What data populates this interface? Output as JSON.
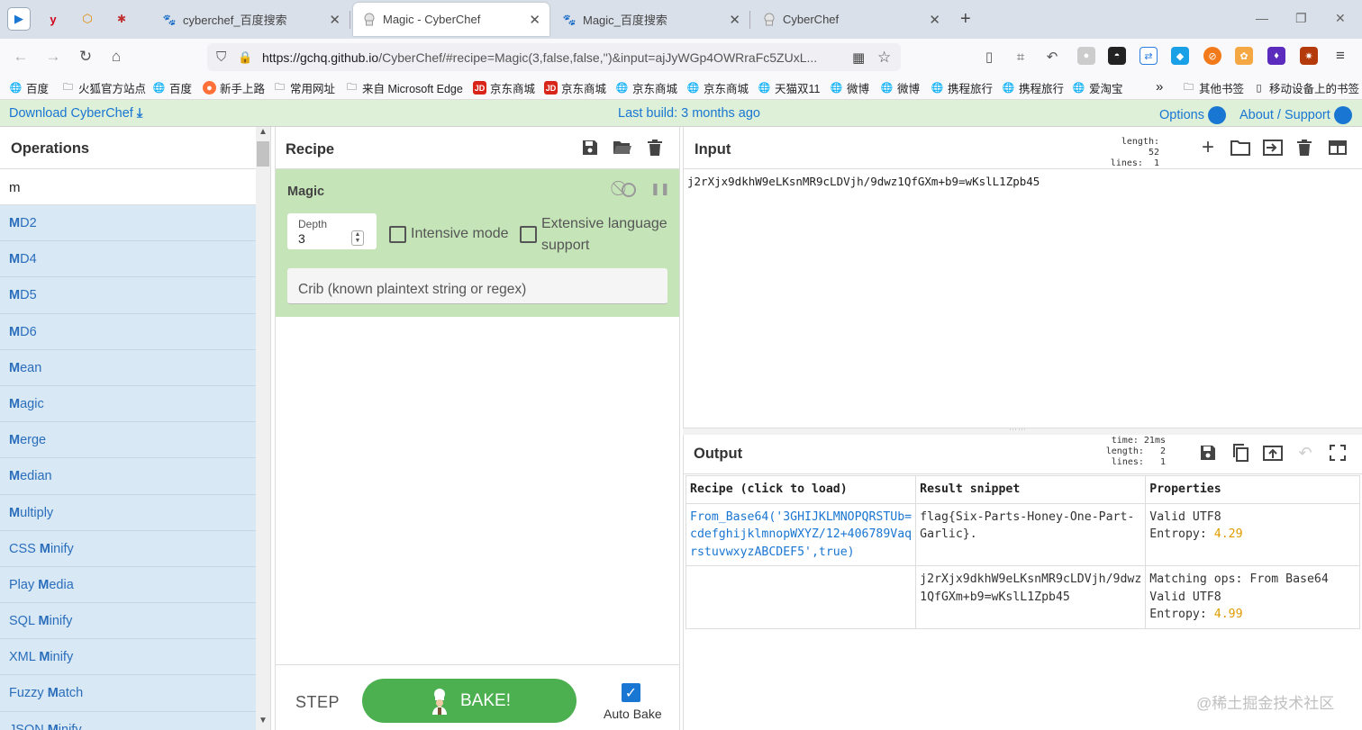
{
  "browser": {
    "tabs": [
      {
        "title": "cyberchef_百度搜索",
        "active": false
      },
      {
        "title": "Magic - CyberChef",
        "active": true
      },
      {
        "title": "Magic_百度搜索",
        "active": false
      },
      {
        "title": "CyberChef",
        "active": false
      }
    ],
    "new_tab_symbol": "+",
    "url_host": "https://gchq.github.io",
    "url_rest": "/CyberChef/#recipe=Magic(3,false,false,'')&input=ajJyWGp4OWRraFc5ZUxL..."
  },
  "bookmarks": [
    {
      "label": "百度",
      "icon": "globe-icon"
    },
    {
      "label": "火狐官方站点",
      "icon": "folder-icon"
    },
    {
      "label": "百度",
      "icon": "globe-icon"
    },
    {
      "label": "新手上路",
      "icon": "firefox-icon"
    },
    {
      "label": "常用网址",
      "icon": "folder-icon"
    },
    {
      "label": "来自 Microsoft Edge",
      "icon": "folder-icon"
    },
    {
      "label": "京东商城",
      "icon": "jd-icon"
    },
    {
      "label": "京东商城",
      "icon": "jd-icon"
    },
    {
      "label": "京东商城",
      "icon": "globe-icon"
    },
    {
      "label": "京东商城",
      "icon": "globe-icon"
    },
    {
      "label": "天猫双11",
      "icon": "globe-icon"
    },
    {
      "label": "微博",
      "icon": "globe-icon"
    },
    {
      "label": "微博",
      "icon": "globe-icon"
    },
    {
      "label": "携程旅行",
      "icon": "globe-icon"
    },
    {
      "label": "携程旅行",
      "icon": "globe-icon"
    },
    {
      "label": "爱淘宝",
      "icon": "globe-icon"
    }
  ],
  "bookmarks_right": [
    {
      "label": "其他书签",
      "icon": "folder-icon"
    },
    {
      "label": "移动设备上的书签",
      "icon": "mobile-icon"
    }
  ],
  "banner": {
    "download": "Download CyberChef",
    "last_build": "Last build: 3 months ago",
    "options": "Options",
    "about": "About / Support"
  },
  "operations": {
    "title": "Operations",
    "search_value": "m",
    "items": [
      {
        "pre": "",
        "match": "M",
        "post": "D2"
      },
      {
        "pre": "",
        "match": "M",
        "post": "D4"
      },
      {
        "pre": "",
        "match": "M",
        "post": "D5"
      },
      {
        "pre": "",
        "match": "M",
        "post": "D6"
      },
      {
        "pre": "",
        "match": "M",
        "post": "ean"
      },
      {
        "pre": "",
        "match": "M",
        "post": "agic"
      },
      {
        "pre": "",
        "match": "M",
        "post": "erge"
      },
      {
        "pre": "",
        "match": "M",
        "post": "edian"
      },
      {
        "pre": "",
        "match": "M",
        "post": "ultiply"
      },
      {
        "pre": "CSS ",
        "match": "M",
        "post": "inify"
      },
      {
        "pre": "Play ",
        "match": "M",
        "post": "edia"
      },
      {
        "pre": "SQL ",
        "match": "M",
        "post": "inify"
      },
      {
        "pre": "XML ",
        "match": "M",
        "post": "inify"
      },
      {
        "pre": "Fuzzy ",
        "match": "M",
        "post": "atch"
      },
      {
        "pre": "JSON ",
        "match": "M",
        "post": "inify"
      }
    ]
  },
  "recipe": {
    "title": "Recipe",
    "operation": {
      "name": "Magic",
      "depth_label": "Depth",
      "depth_value": "3",
      "intensive_label": "Intensive mode",
      "intensive_checked": false,
      "extensive_label_1": "Extensive language",
      "extensive_label_2": "support",
      "extensive_checked": false,
      "crib_placeholder": "Crib (known plaintext string or regex)"
    },
    "step_label": "STEP",
    "bake_label": "BAKE!",
    "autobake_label": "Auto Bake",
    "autobake_checked": true
  },
  "input": {
    "title": "Input",
    "length_label": "length:",
    "length_value": "52",
    "lines_label": "lines:",
    "lines_value": "1",
    "text": "j2rXjx9dkhW9eLKsnMR9cLDVjh/9dwz1QfGXm+b9=wKslL1Zpb45"
  },
  "output": {
    "title": "Output",
    "time_label": "time:",
    "time_value": "21ms",
    "length_label": "length:",
    "length_value": "2",
    "lines_label": "lines:",
    "lines_value": "1",
    "table_headers": [
      "Recipe (click to load)",
      "Result snippet",
      "Properties"
    ],
    "rows": [
      {
        "recipe_lines": [
          "From_Base64('3GHIJKLMNOPQRSTUb=",
          "cdefghijklmnopWXYZ/12+406789Vaq",
          "rstuvwxyzABCDEF5',true)"
        ],
        "snippet_lines": [
          "flag{Six-Parts-Honey-One-Part-",
          "Garlic}."
        ],
        "props": [
          {
            "text": "Valid UTF8"
          }
        ],
        "entropy_label": "Entropy: ",
        "entropy_value": "4.29"
      },
      {
        "recipe_lines": [],
        "snippet_lines": [
          "j2rXjx9dkhW9eLKsnMR9cLDVjh/9dwz",
          "1QfGXm+b9=wKslL1Zpb45"
        ],
        "props": [
          {
            "text": "Matching ops: From Base64"
          },
          {
            "text": "Valid UTF8"
          }
        ],
        "entropy_label": "Entropy: ",
        "entropy_value": "4.99"
      }
    ]
  },
  "watermark": "@稀土掘金技术社区",
  "colors": {
    "recipe_op_bg": "#c5e4b8",
    "ops_list_bg": "#d9e8f5",
    "bake_green": "#4caf50",
    "link_blue": "#1976d2",
    "entropy_orange": "#e09b00"
  }
}
